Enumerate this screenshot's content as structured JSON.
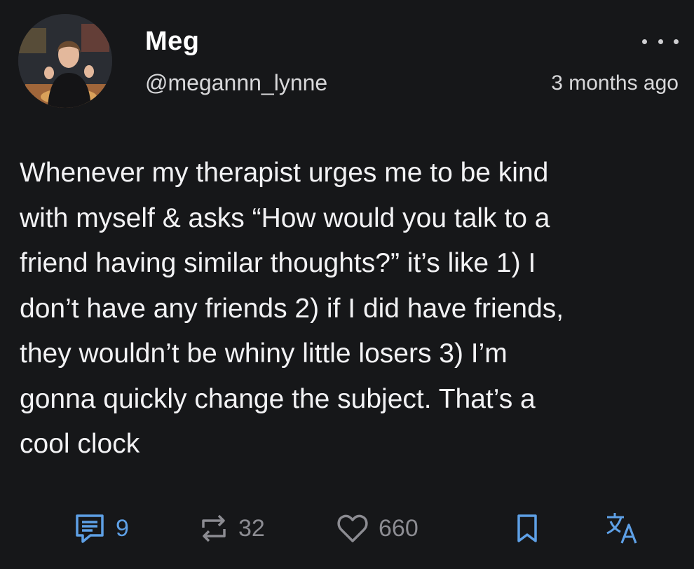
{
  "author": {
    "display_name": "Meg",
    "handle": "@megannn_lynne",
    "avatar_icon": "profile-photo"
  },
  "meta": {
    "timestamp": "3 months ago",
    "more_icon": "more-horizontal-icon"
  },
  "post": {
    "text": "Whenever my therapist urges me to be kind\nwith myself & asks “How would you talk to a\nfriend having similar thoughts?” it’s like 1) I\ndon’t have any friends 2) if I did have friends,\nthey wouldn’t be whiny little losers 3) I’m\ngonna quickly change the subject. That’s a\ncool clock"
  },
  "actions": {
    "replies": {
      "icon": "comment-icon",
      "count": "9"
    },
    "reposts": {
      "icon": "repost-icon",
      "count": "32"
    },
    "likes": {
      "icon": "heart-icon",
      "count": "660"
    },
    "bookmark": {
      "icon": "bookmark-icon"
    },
    "translate": {
      "icon": "translate-icon"
    }
  },
  "colors": {
    "background": "#161719",
    "accent": "#5ea0e6",
    "muted": "#8c8c92",
    "text": "#f2f2f4"
  }
}
